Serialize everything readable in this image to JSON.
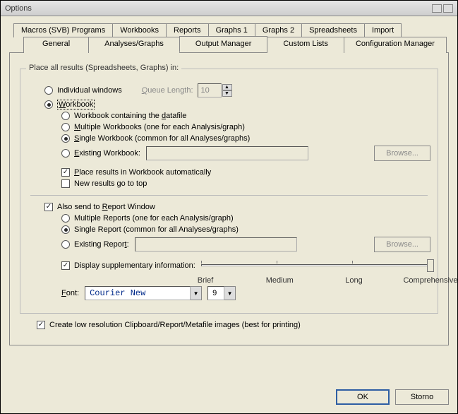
{
  "title": "Options",
  "tabs_row1": [
    "Macros (SVB) Programs",
    "Workbooks",
    "Reports",
    "Graphs 1",
    "Graphs 2",
    "Spreadsheets",
    "Import"
  ],
  "tabs_row2": [
    "General",
    "Analyses/Graphs",
    "Output Manager",
    "Custom Lists",
    "Configuration Manager"
  ],
  "active_tab": "Output Manager",
  "group": {
    "legend": "Place all results (Spreadsheets, Graphs) in:",
    "individual": "Individual windows",
    "queue_label": "Queue Length:",
    "queue_value": "10",
    "workbook": "Workbook",
    "wb_contain": "Workbook containing the datafile",
    "wb_multi": "Multiple Workbooks (one for each Analysis/graph)",
    "wb_single": "Single Workbook (common for all Analyses/graphs)",
    "wb_exist": "Existing Workbook:",
    "browse1": "Browse...",
    "wb_auto": "Place results in Workbook automatically",
    "wb_newtop": "New results go to top",
    "also_report": "Also send to Report Window",
    "rp_multi": "Multiple Reports (one for each Analysis/graph)",
    "rp_single": "Single Report (common for all Analyses/graphs)",
    "rp_exist": "Existing Report:",
    "browse2": "Browse...",
    "disp_supp": "Display supplementary information:",
    "slider": {
      "labels": [
        "Brief",
        "Medium",
        "Long",
        "Comprehensive"
      ]
    },
    "font_label": "Font:",
    "font_value": "Courier New",
    "font_size": "9"
  },
  "lowres": "Create low resolution Clipboard/Report/Metafile images (best for printing)",
  "buttons": {
    "ok": "OK",
    "cancel": "Storno"
  }
}
